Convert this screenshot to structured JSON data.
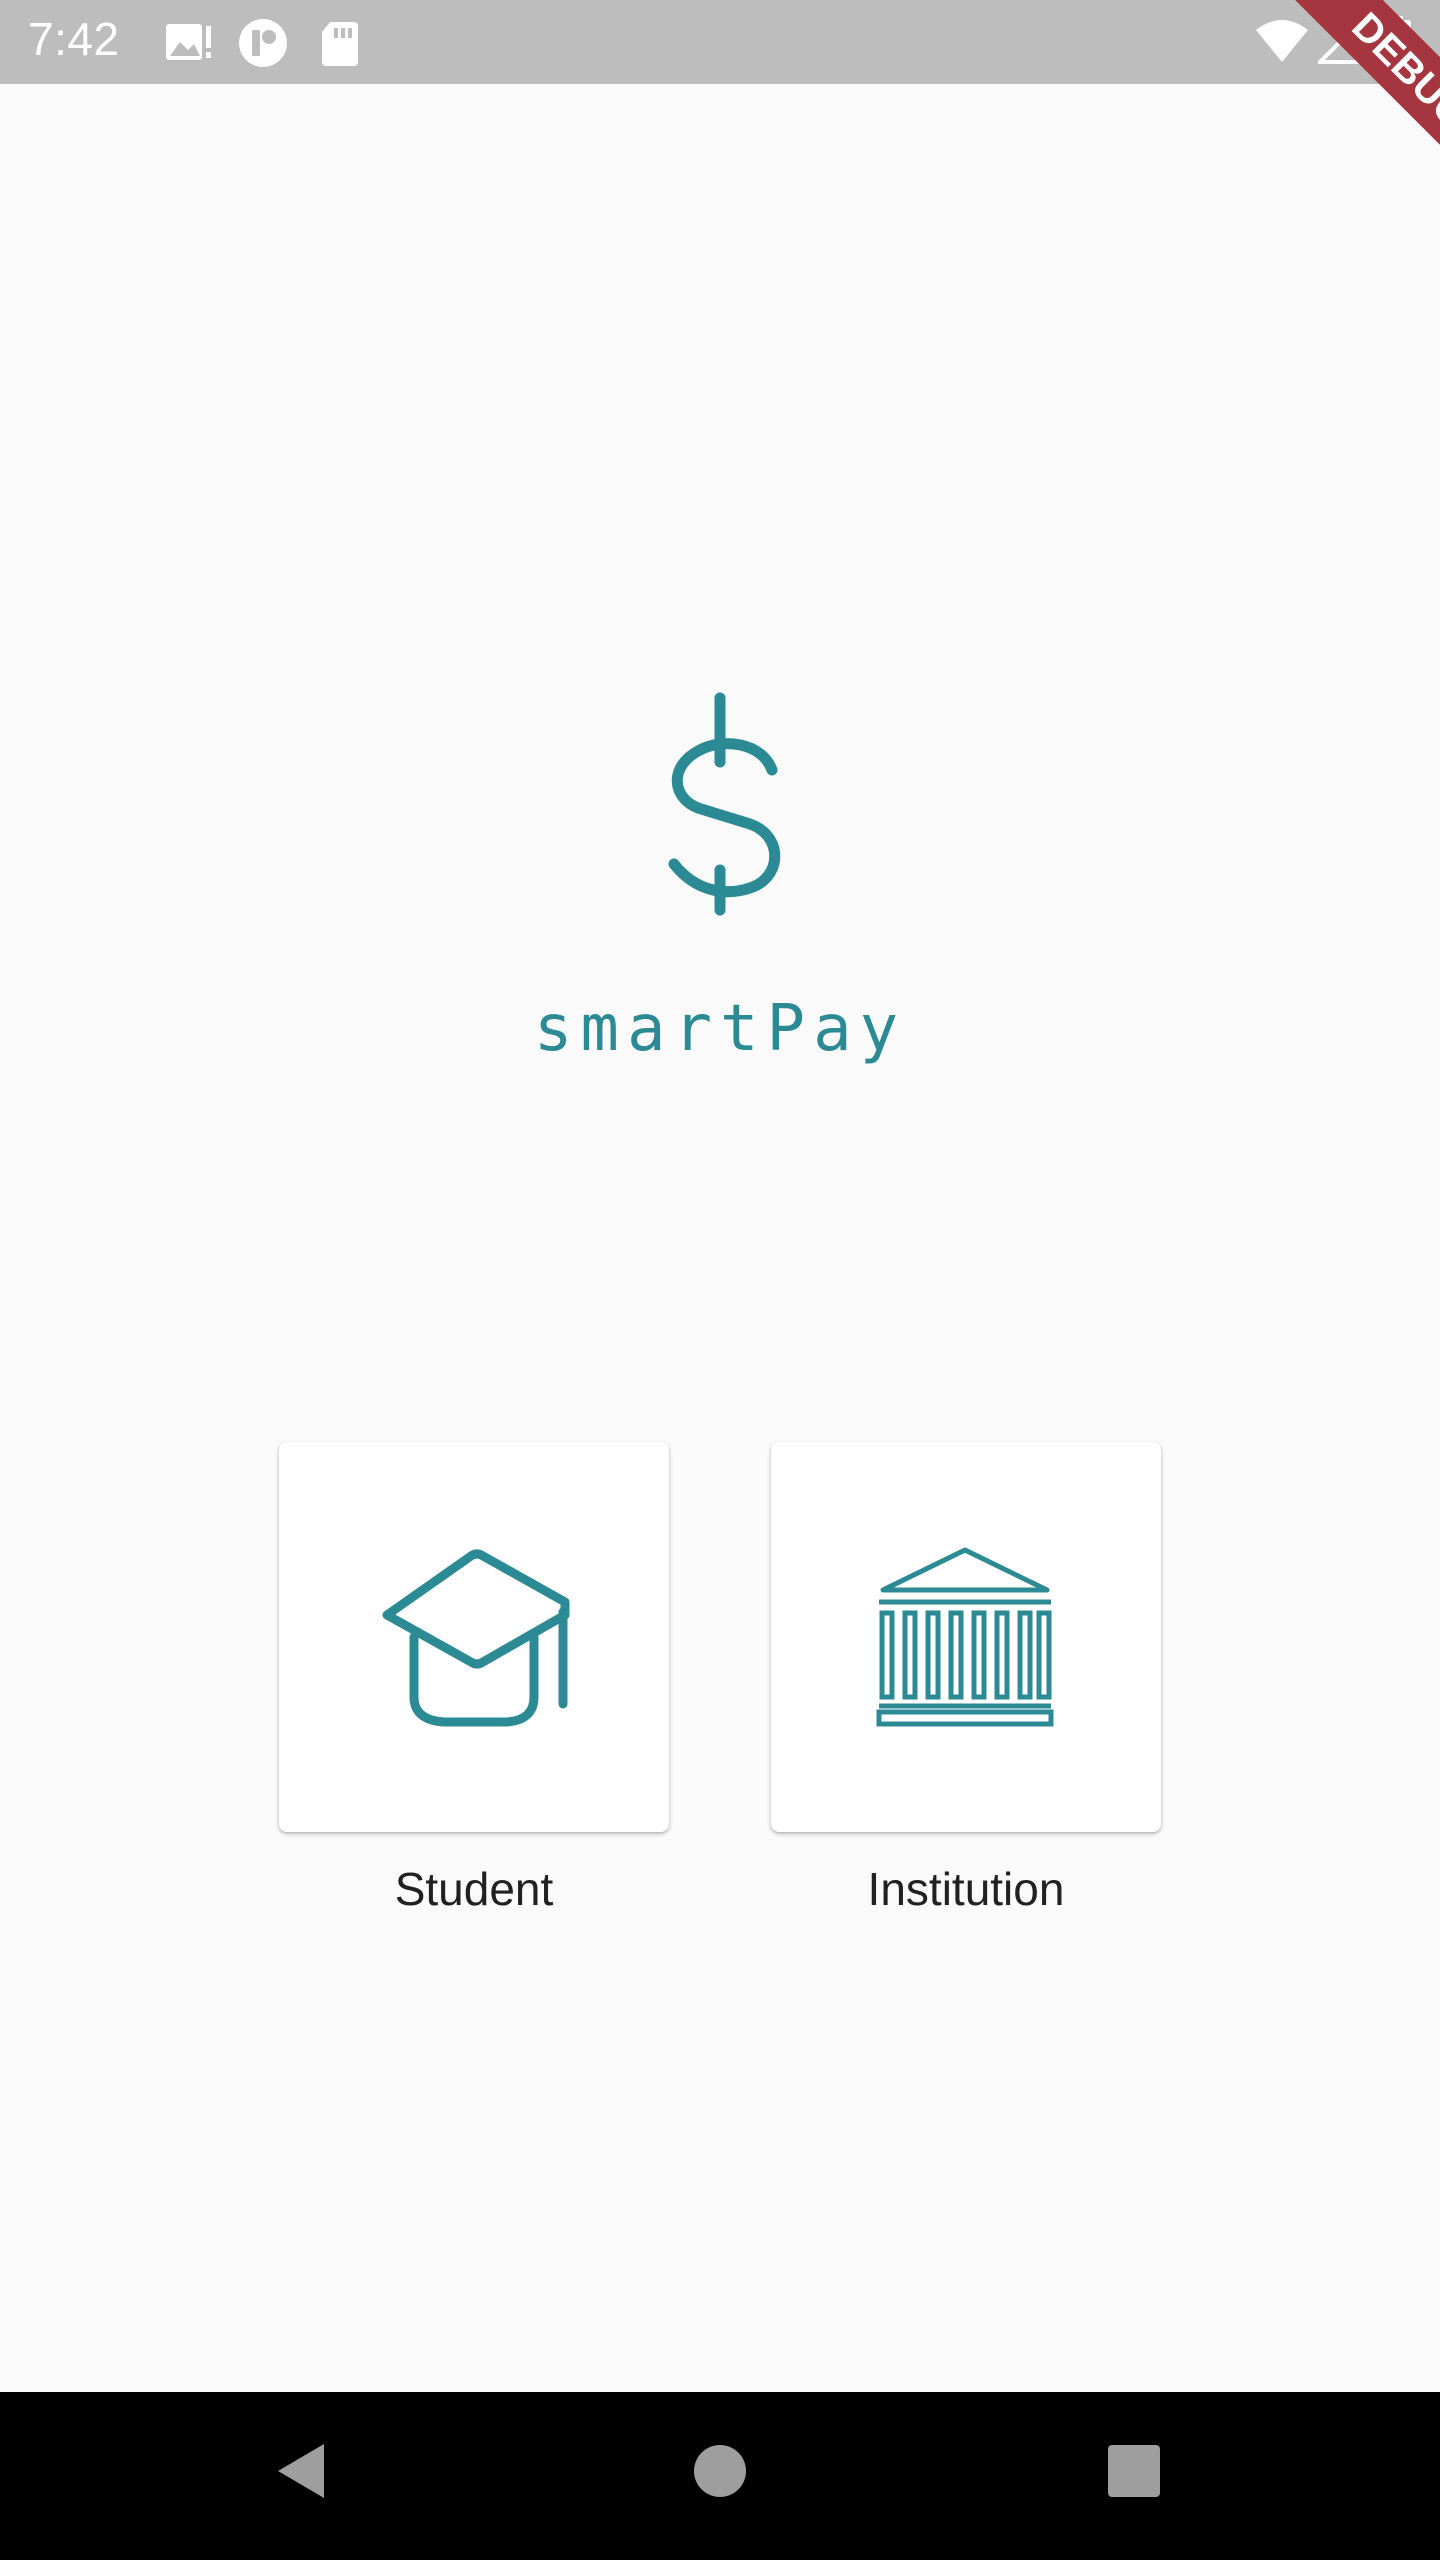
{
  "status_bar": {
    "time": "7:42",
    "left_icons": [
      "image-alert-icon",
      "app-indicator-icon",
      "sd-card-icon"
    ],
    "right_icons": [
      "wifi-icon",
      "signal-icon",
      "battery-icon"
    ]
  },
  "debug_banner": {
    "label": "DEBUG",
    "color": "#a5353e"
  },
  "app": {
    "logo_icon": "dollar-sign-icon",
    "brand_name": "smartPay",
    "brand_color": "#2b8a94"
  },
  "role_cards": [
    {
      "label": "Student",
      "icon": "graduation-cap-icon"
    },
    {
      "label": "Institution",
      "icon": "institution-building-icon"
    }
  ],
  "nav_bar": {
    "buttons": [
      "back-icon",
      "home-icon",
      "recents-icon"
    ]
  }
}
